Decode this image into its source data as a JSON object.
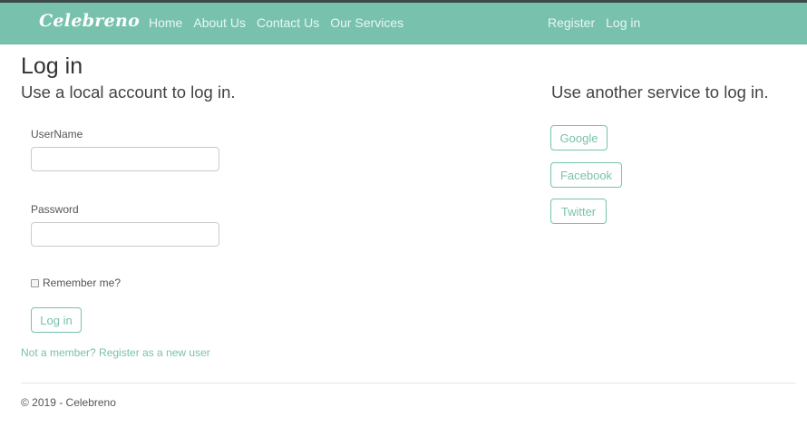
{
  "navbar": {
    "brand": "Celebreno",
    "links": [
      "Home",
      "About Us",
      "Contact Us",
      "Our Services"
    ],
    "right_links": [
      "Register",
      "Log in"
    ]
  },
  "page": {
    "title": "Log in",
    "local_heading": "Use a local account to log in.",
    "external_heading": "Use another service to log in."
  },
  "form": {
    "username_label": "UserName",
    "username_value": "",
    "password_label": "Password",
    "password_value": "",
    "remember_label": "Remember me?",
    "remember_checked": false,
    "submit_label": "Log in",
    "register_link": "Not a member? Register as a new user"
  },
  "external_providers": [
    "Google",
    "Facebook",
    "Twitter"
  ],
  "footer": {
    "text": "© 2019 - Celebreno"
  },
  "colors": {
    "accent": "#78c2ad",
    "navbar": "#78c2ad"
  }
}
